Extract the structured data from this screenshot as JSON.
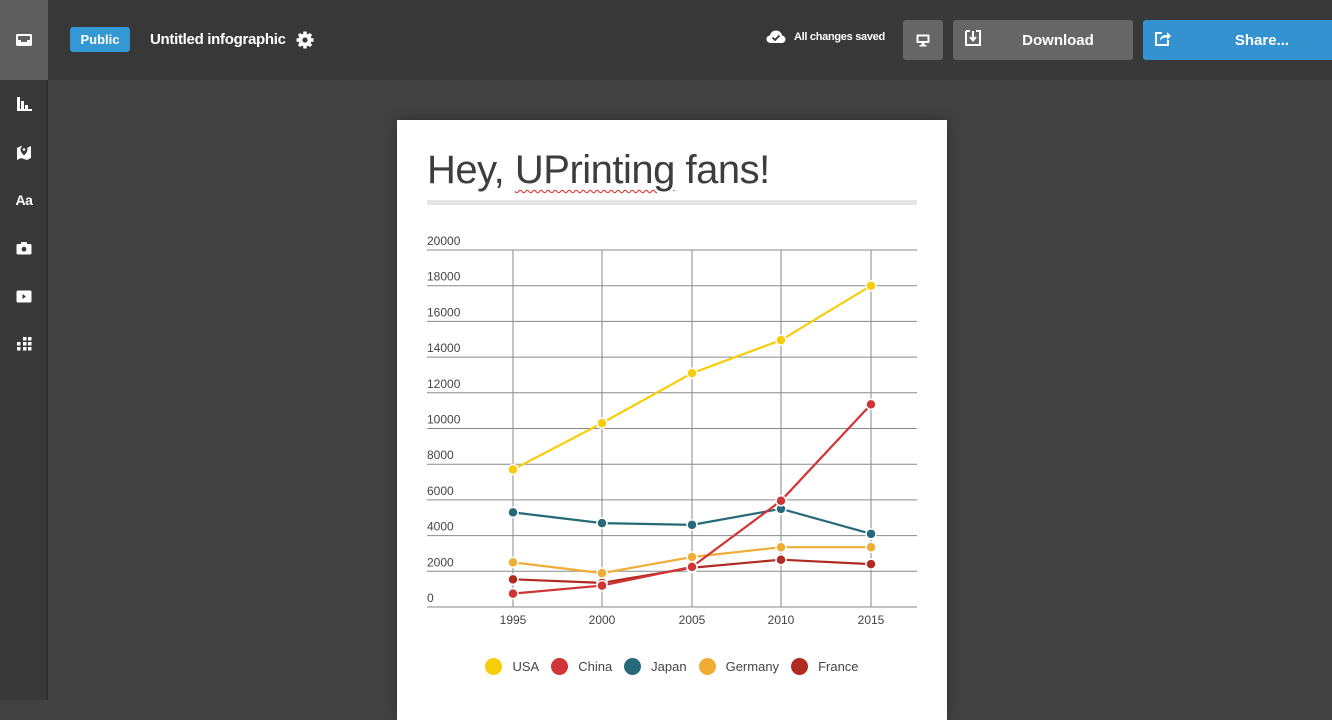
{
  "sidebar": {
    "home_icon": "inbox-tray-icon",
    "items": [
      {
        "name": "charts",
        "icon": "bar-chart-icon"
      },
      {
        "name": "maps",
        "icon": "map-pin-icon"
      },
      {
        "name": "text",
        "icon": "text-aa-icon",
        "glyph": "Aa"
      },
      {
        "name": "photos",
        "icon": "camera-icon"
      },
      {
        "name": "videos",
        "icon": "video-play-icon"
      },
      {
        "name": "more",
        "icon": "grid-icon"
      }
    ]
  },
  "topbar": {
    "visibility_badge": "Public",
    "document_title": "Untitled infographic",
    "save_status": "All changes saved",
    "preview_icon": "monitor-icon",
    "download_label": "Download",
    "share_label": "Share..."
  },
  "colors": {
    "accent": "#3498d5",
    "usa": "#f7cd0a",
    "china": "#d03434",
    "japan": "#266a7a",
    "germany": "#f0ad35",
    "france": "#b02a22"
  },
  "page": {
    "heading_pre": "Hey, ",
    "heading_misspelled": "UPrinting",
    "heading_post": " fans!"
  },
  "chart_data": {
    "type": "line",
    "title": "",
    "xlabel": "",
    "ylabel": "",
    "x": [
      "1995",
      "2000",
      "2005",
      "2010",
      "2015"
    ],
    "ylim": [
      0,
      20000
    ],
    "yticks": [
      0,
      2000,
      4000,
      6000,
      8000,
      10000,
      12000,
      14000,
      16000,
      18000,
      20000
    ],
    "grid": true,
    "legend_position": "bottom",
    "series": [
      {
        "name": "USA",
        "color": "#f7cd0a",
        "values": [
          7700,
          10300,
          13100,
          14950,
          18000
        ]
      },
      {
        "name": "China",
        "color": "#d03434",
        "values": [
          750,
          1200,
          2250,
          5950,
          11350
        ]
      },
      {
        "name": "Japan",
        "color": "#266a7a",
        "values": [
          5300,
          4700,
          4600,
          5500,
          4100
        ]
      },
      {
        "name": "Germany",
        "color": "#f0ad35",
        "values": [
          2500,
          1900,
          2800,
          3350,
          3350
        ]
      },
      {
        "name": "France",
        "color": "#b02a22",
        "values": [
          1550,
          1350,
          2200,
          2650,
          2400
        ]
      }
    ]
  }
}
